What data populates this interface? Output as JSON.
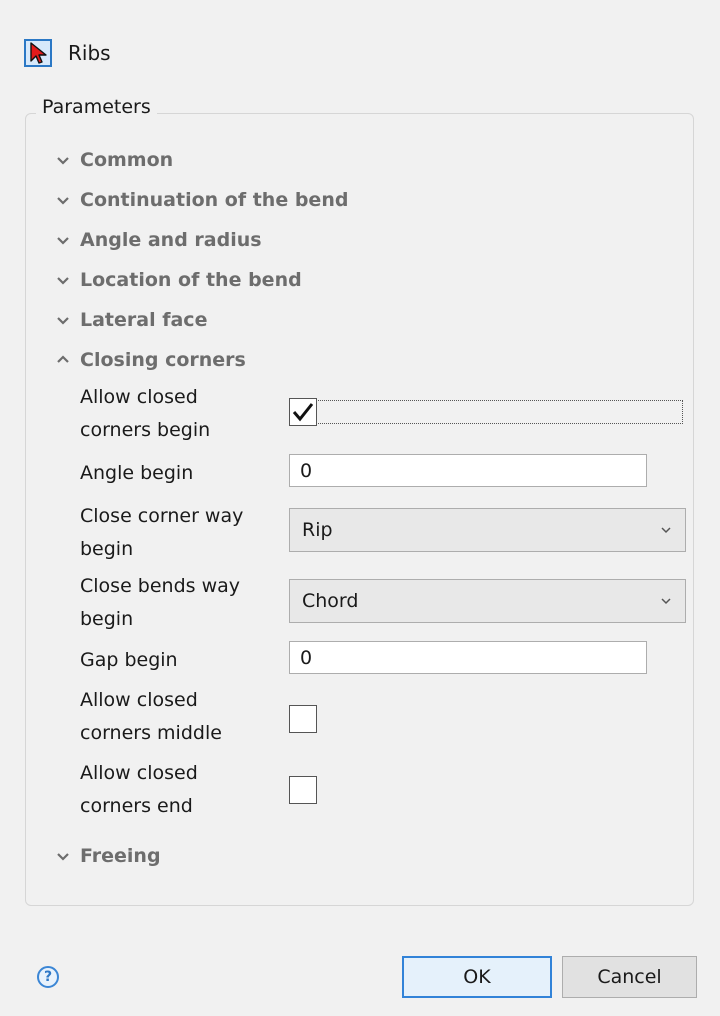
{
  "tool": {
    "title": "Ribs",
    "icon": "cursor-arrow-icon"
  },
  "parameters": {
    "legend": "Parameters",
    "sections": [
      {
        "label": "Common",
        "expanded": false
      },
      {
        "label": "Continuation of the bend",
        "expanded": false
      },
      {
        "label": "Angle and radius",
        "expanded": false
      },
      {
        "label": "Location of the bend",
        "expanded": false
      },
      {
        "label": "Lateral face",
        "expanded": false
      },
      {
        "label": "Closing corners",
        "expanded": true
      },
      {
        "label": "Freeing",
        "expanded": false
      }
    ],
    "closing_corners": {
      "allow_closed_begin": {
        "label_line1": "Allow closed",
        "label_line2": "corners begin",
        "checked": true
      },
      "angle_begin": {
        "label": "Angle begin",
        "value": "0"
      },
      "close_corner_way_begin": {
        "label_line1": "Close corner way",
        "label_line2": "begin",
        "value": "Rip"
      },
      "close_bends_way_begin": {
        "label_line1": "Close bends way",
        "label_line2": "begin",
        "value": "Chord"
      },
      "gap_begin": {
        "label": "Gap begin",
        "value": "0"
      },
      "allow_closed_middle": {
        "label_line1": "Allow closed",
        "label_line2": "corners middle",
        "checked": false
      },
      "allow_closed_end": {
        "label_line1": "Allow closed",
        "label_line2": "corners end",
        "checked": false
      }
    }
  },
  "footer": {
    "help_icon": "?",
    "ok_label": "OK",
    "cancel_label": "Cancel"
  },
  "colors": {
    "accent": "#3283d8",
    "section_text": "#6d6d6d",
    "background": "#f1f1f1"
  }
}
